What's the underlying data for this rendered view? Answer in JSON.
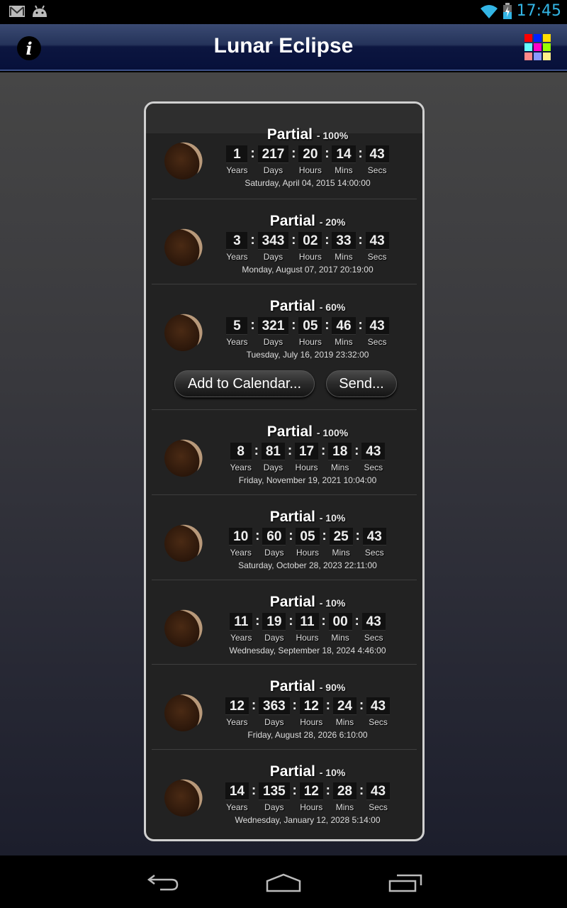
{
  "status_bar": {
    "time": "17:45",
    "left_icons": [
      "gmail-icon",
      "android-icon"
    ],
    "right_icons": [
      "wifi-icon",
      "battery-charging-icon"
    ]
  },
  "action_bar": {
    "title": "Lunar Eclipse",
    "info_label": "i",
    "grid_colors": [
      "#ff0000",
      "#0022ff",
      "#ffdd00",
      "#66ffff",
      "#ff00cc",
      "#99ff00",
      "#ff8888",
      "#8899ff",
      "#ffee88"
    ]
  },
  "eclipses": [
    {
      "type": "Partial",
      "percent": "- 100%",
      "years": "1",
      "days": "217",
      "hours": "20",
      "mins": "14",
      "secs": "43",
      "date": "Saturday, April 04, 2015  14:00:00"
    },
    {
      "type": "Partial",
      "percent": "- 20%",
      "years": "3",
      "days": "343",
      "hours": "02",
      "mins": "33",
      "secs": "43",
      "date": "Monday, August 07, 2017  20:19:00"
    },
    {
      "type": "Partial",
      "percent": "- 60%",
      "years": "5",
      "days": "321",
      "hours": "05",
      "mins": "46",
      "secs": "43",
      "date": "Tuesday, July 16, 2019  23:32:00"
    },
    {
      "type": "Partial",
      "percent": "- 100%",
      "years": "8",
      "days": "81",
      "hours": "17",
      "mins": "18",
      "secs": "43",
      "date": "Friday, November 19, 2021  10:04:00"
    },
    {
      "type": "Partial",
      "percent": "- 10%",
      "years": "10",
      "days": "60",
      "hours": "05",
      "mins": "25",
      "secs": "43",
      "date": "Saturday, October 28, 2023  22:11:00"
    },
    {
      "type": "Partial",
      "percent": "- 10%",
      "years": "11",
      "days": "19",
      "hours": "11",
      "mins": "00",
      "secs": "43",
      "date": "Wednesday, September 18, 2024  4:46:00"
    },
    {
      "type": "Partial",
      "percent": "- 90%",
      "years": "12",
      "days": "363",
      "hours": "12",
      "mins": "24",
      "secs": "43",
      "date": "Friday, August 28, 2026  6:10:00"
    },
    {
      "type": "Partial",
      "percent": "- 10%",
      "years": "14",
      "days": "135",
      "hours": "12",
      "mins": "28",
      "secs": "43",
      "date": "Wednesday, January 12, 2028  5:14:00"
    }
  ],
  "unit_labels": {
    "years": "Years",
    "days": "Days",
    "hours": "Hours",
    "mins": "Mins",
    "secs": "Secs"
  },
  "actions": {
    "add_to_calendar": "Add to Calendar...",
    "send": "Send..."
  },
  "nav_bar": {
    "icons": [
      "back-icon",
      "home-icon",
      "recent-apps-icon"
    ]
  }
}
